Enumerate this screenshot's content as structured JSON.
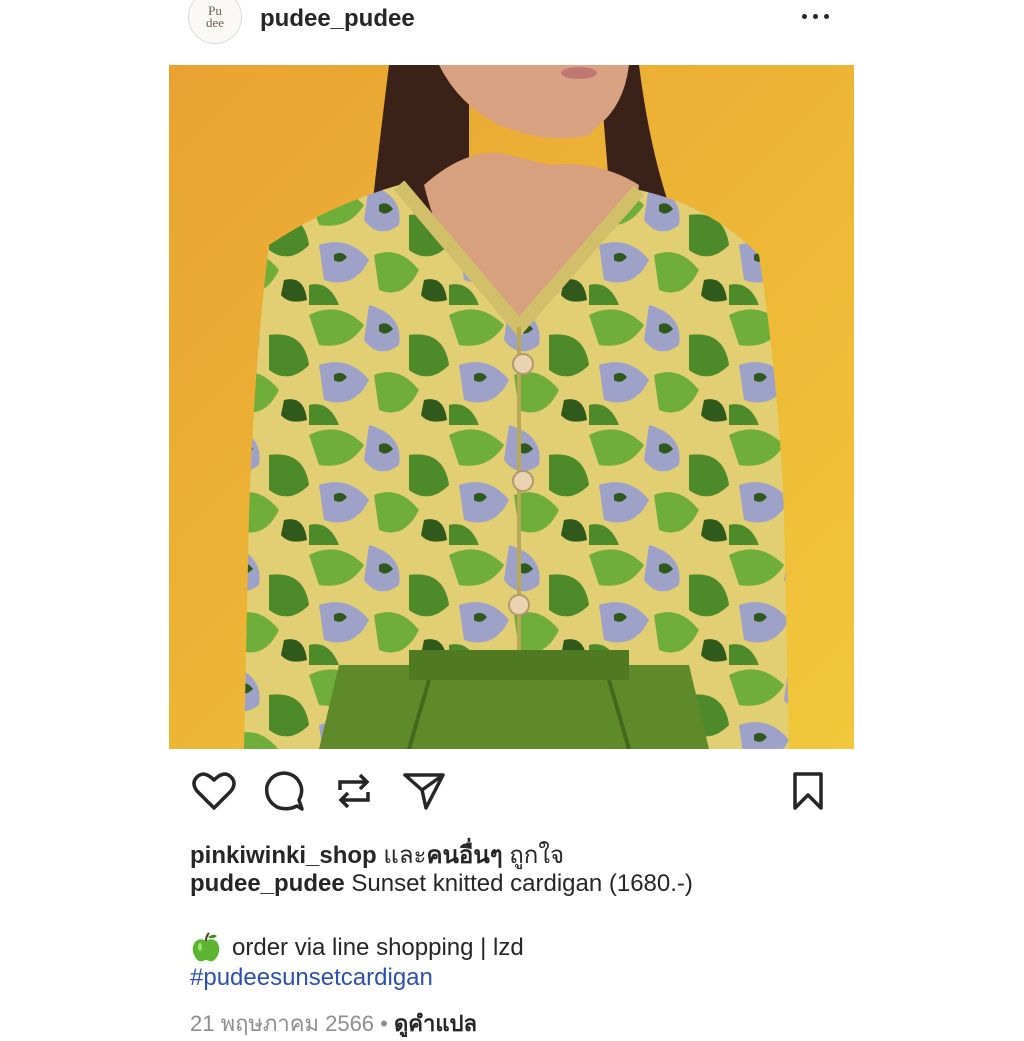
{
  "post": {
    "author": "pudee_pudee",
    "avatar_text_line1": "Pu",
    "avatar_text_line2": "dee",
    "more_icon": "more-horizontal-icon"
  },
  "actions": {
    "like_icon": "heart-icon",
    "comment_icon": "comment-icon",
    "repost_icon": "repost-icon",
    "share_icon": "send-icon",
    "save_icon": "bookmark-icon"
  },
  "likes": {
    "first_liker": "pinkiwinki_shop",
    "connector": " และ",
    "others": "คนอื่นๆ",
    "suffix": " ถูกใจ"
  },
  "caption": {
    "author": "pudee_pudee",
    "text": " Sunset knitted cardigan (1680.-)",
    "order_emoji": "green-apple-icon",
    "order_line": "order via line shopping | lzd",
    "hashtag": "#pudeesunsetcardigan"
  },
  "meta": {
    "date": "21 พฤษภาคม 2566",
    "separator": " • ",
    "translate_link": "ดูคำแปล"
  },
  "colors": {
    "text": "#262626",
    "hashtag": "#2d4fb5",
    "muted": "#8e8e8e",
    "photo_background": "#f0b43a",
    "skirt": "#5e8a2a"
  }
}
